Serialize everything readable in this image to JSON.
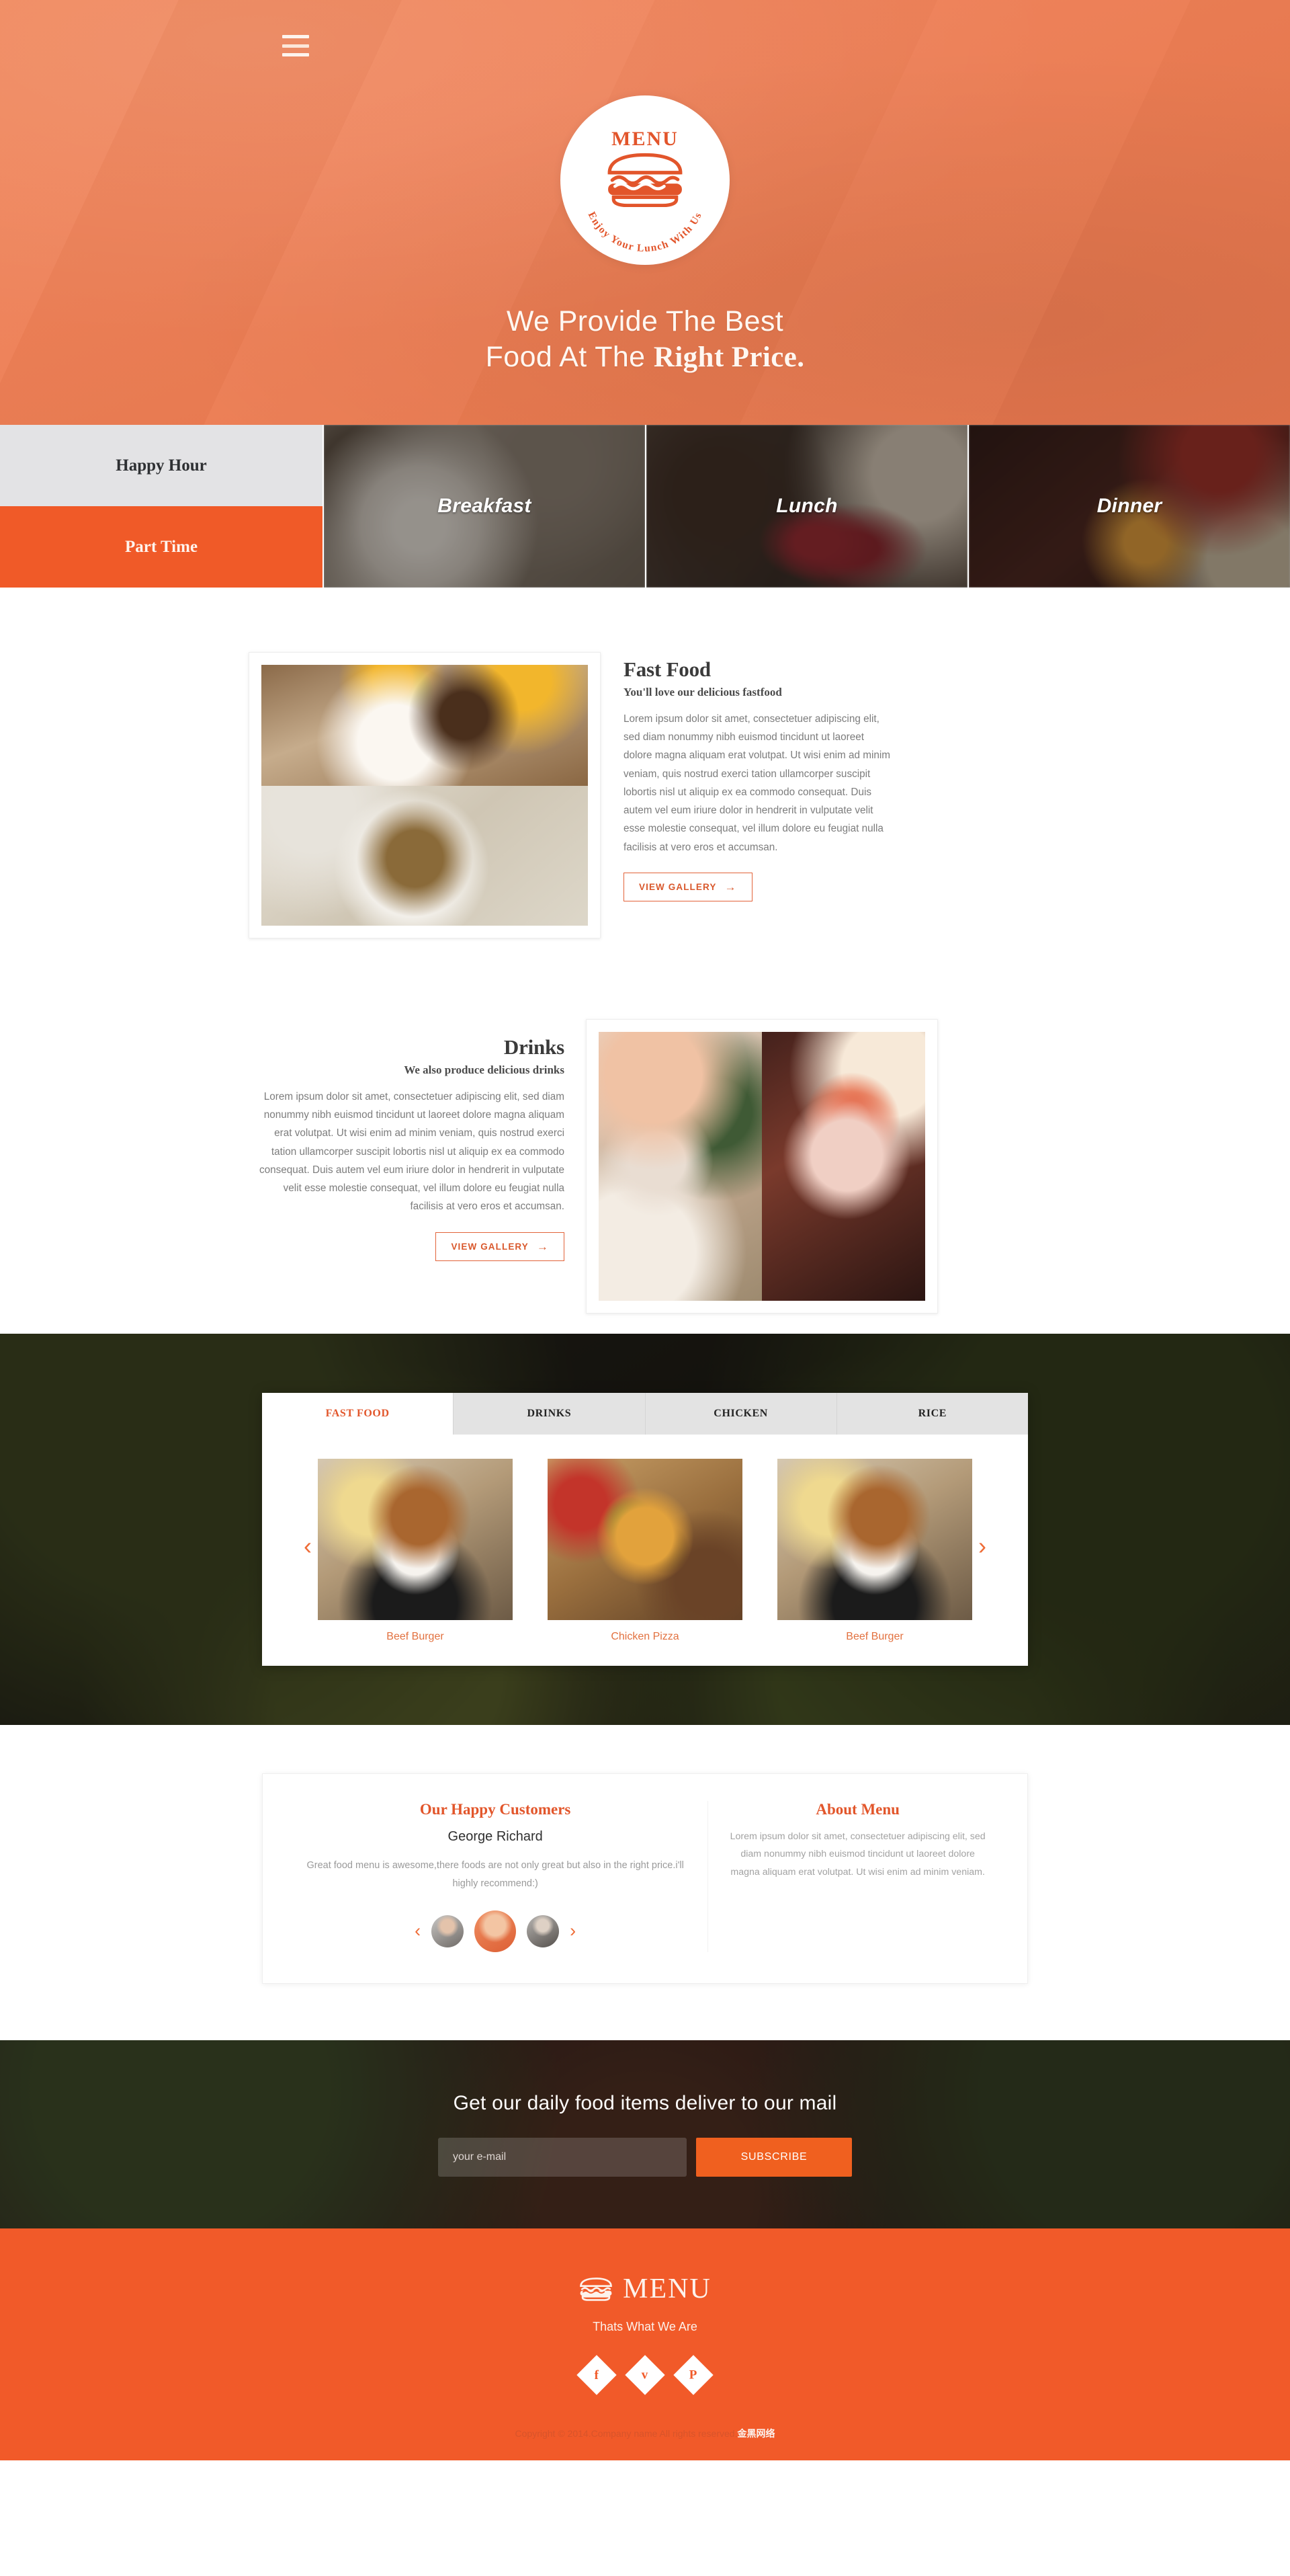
{
  "hero": {
    "menu_icon": "hamburger-menu-icon",
    "badge": {
      "word": "MENU",
      "icon": "burger-icon",
      "arc_text": "Enjoy Your Lunch With Us"
    },
    "title_line1": "We Provide The Best",
    "title_line2_plain": "Food At The ",
    "title_line2_bold": "Right Price."
  },
  "strip": {
    "tabs": [
      {
        "label": "Happy Hour",
        "active": false
      },
      {
        "label": "Part Time",
        "active": true
      }
    ],
    "meals": [
      {
        "label": "Breakfast"
      },
      {
        "label": "Lunch"
      },
      {
        "label": "Dinner"
      }
    ]
  },
  "fastfood": {
    "title": "Fast Food",
    "subtitle": "You'll love our delicious fastfood",
    "body": "Lorem ipsum dolor sit amet, consectetuer adipiscing elit, sed diam nonummy nibh euismod tincidunt ut laoreet dolore magna aliquam erat volutpat. Ut wisi enim ad minim veniam, quis nostrud exerci tation ullamcorper suscipit lobortis nisl ut aliquip ex ea commodo consequat. Duis autem vel eum iriure dolor in hendrerit in vulputate velit esse molestie consequat, vel illum dolore eu feugiat nulla facilisis at vero eros et accumsan.",
    "button": "VIEW GALLERY",
    "button_arrow": "→"
  },
  "drinks": {
    "title": "Drinks",
    "subtitle": "We also produce delicious drinks",
    "body": "Lorem ipsum dolor sit amet, consectetuer adipiscing elit, sed diam nonummy nibh euismod tincidunt ut laoreet dolore magna aliquam erat volutpat. Ut wisi enim ad minim veniam, quis nostrud exerci tation ullamcorper suscipit lobortis nisl ut aliquip ex ea commodo consequat. Duis autem vel eum iriure dolor in hendrerit in vulputate velit esse molestie consequat, vel illum dolore eu feugiat nulla facilisis at vero eros et accumsan.",
    "button": "VIEW GALLERY",
    "button_arrow": "→"
  },
  "gallery": {
    "tabs": [
      {
        "label": "FAST FOOD",
        "active": true
      },
      {
        "label": "DRINKS",
        "active": false
      },
      {
        "label": "CHICKEN",
        "active": false
      },
      {
        "label": "RICE",
        "active": false
      }
    ],
    "prev_arrow": "‹",
    "next_arrow": "›",
    "items": [
      {
        "caption": "Beef Burger",
        "kind": "burger"
      },
      {
        "caption": "Chicken Pizza",
        "kind": "pizza"
      },
      {
        "caption": "Beef Burger",
        "kind": "burger"
      }
    ]
  },
  "testimonials": {
    "title": "Our Happy Customers",
    "name": "George Richard",
    "quote": "Great food menu is awesome,there foods are not only great but also in the right price.i'll highly recommend:)",
    "prev_arrow": "‹",
    "next_arrow": "›",
    "about": {
      "title": "About Menu",
      "body": "Lorem ipsum dolor sit amet, consectetuer adipiscing elit, sed diam nonummy nibh euismod tincidunt ut laoreet dolore magna aliquam erat volutpat. Ut wisi enim ad minim veniam."
    }
  },
  "subscribe": {
    "title": "Get our daily food items deliver to our mail",
    "placeholder": "your e-mail",
    "value": "",
    "button": "SUBSCRIBE"
  },
  "footer": {
    "logo_icon": "burger-icon",
    "logo_word": "MENU",
    "tagline": "Thats What We Are",
    "socials": [
      {
        "name": "facebook-icon",
        "glyph": "f"
      },
      {
        "name": "twitter-icon",
        "glyph": "ᴠ"
      },
      {
        "name": "pinterest-icon",
        "glyph": "P"
      }
    ],
    "copyright": "Copyright © 2014.Company name All rights reserved.",
    "copyright_brand": "金黑网络"
  },
  "colors": {
    "brand_orange": "#f15a29",
    "hero_orange": "#ee8057",
    "accent_text": "#e2562b",
    "muted_text": "#7c7c7c"
  }
}
